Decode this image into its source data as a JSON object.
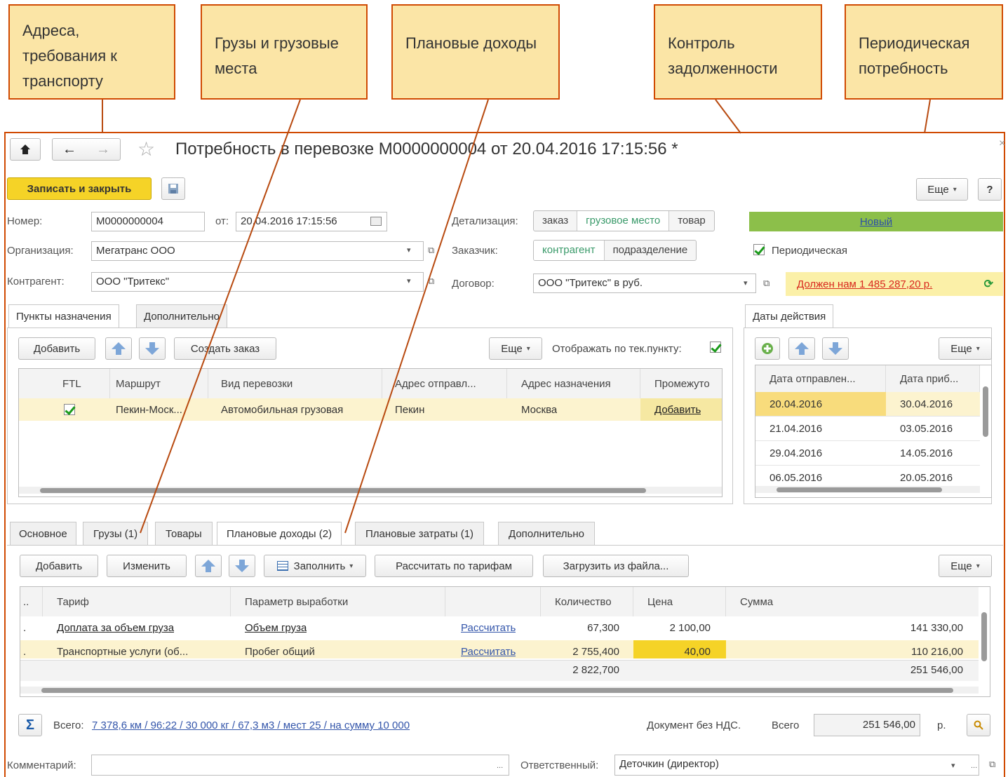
{
  "callouts": [
    "Адреса, требования к транспорту",
    "Грузы и грузовые места",
    "Плановые доходы",
    "Контроль задолженности",
    "Периодическая потребность"
  ],
  "window": {
    "title": "Потребность в перевозке М0000000004 от 20.04.2016 17:15:56 *",
    "close": "×"
  },
  "toolbar": {
    "save_close": "Записать и закрыть",
    "more": "Еще",
    "help": "?"
  },
  "form": {
    "number_label": "Номер:",
    "number_value": "М0000000004",
    "date_label": "от:",
    "date_value": "20.04.2016 17:15:56",
    "org_label": "Организация:",
    "org_value": "Мегатранс ООО",
    "contragent_label": "Контрагент:",
    "contragent_value": "ООО \"Тритекс\"",
    "detail_label": "Детализация:",
    "detail_options": [
      "заказ",
      "грузовое место",
      "товар"
    ],
    "customer_label": "Заказчик:",
    "customer_options": [
      "контрагент",
      "подразделение"
    ],
    "contract_label": "Договор:",
    "contract_value": "ООО \"Тритекс\" в руб.",
    "status": "Новый",
    "periodic_label": "Периодическая",
    "debt": "Должен нам 1 485 287,20 р."
  },
  "upper_tabs": [
    "Пункты назначения",
    "Дополнительно"
  ],
  "destinations": {
    "add": "Добавить",
    "create_order": "Создать заказ",
    "more": "Еще",
    "show_by_point": "Отображать по тек.пункту:",
    "columns": [
      "FTL",
      "Маршрут",
      "Вид перевозки",
      "Адрес отправл...",
      "Адрес назначения",
      "Промежуто"
    ],
    "row": {
      "route": "Пекин-Моск...",
      "transport": "Автомобильная грузовая",
      "from": "Пекин",
      "to": "Москва",
      "intermediate": "Добавить"
    }
  },
  "dates_panel": {
    "tab": "Даты действия",
    "more": "Еще",
    "columns": [
      "Дата отправлен...",
      "Дата приб..."
    ],
    "rows": [
      [
        "20.04.2016",
        "30.04.2016"
      ],
      [
        "21.04.2016",
        "03.05.2016"
      ],
      [
        "29.04.2016",
        "14.05.2016"
      ],
      [
        "06.05.2016",
        "20.05.2016"
      ]
    ]
  },
  "lower_tabs": [
    "Основное",
    "Грузы (1)",
    "Товары",
    "Плановые доходы (2)",
    "Плановые затраты (1)",
    "Дополнительно"
  ],
  "income": {
    "add": "Добавить",
    "edit": "Изменить",
    "fill": "Заполнить",
    "calc_tariffs": "Рассчитать по тарифам",
    "load_file": "Загрузить из файла...",
    "more": "Еще",
    "columns": [
      "Тариф",
      "Параметр выработки",
      "",
      "Количество",
      "Цена",
      "Сумма"
    ],
    "rows": [
      {
        "tariff": "Доплата за объем груза",
        "param": "Объем груза",
        "action": "Рассчитать",
        "qty": "67,300",
        "price": "2 100,00",
        "sum": "141 330,00"
      },
      {
        "tariff": "Транспортные услуги (об...",
        "param": "Пробег общий",
        "action": "Рассчитать",
        "qty": "2 755,400",
        "price": "40,00",
        "sum": "110 216,00"
      }
    ],
    "total_qty": "2 822,700",
    "total_sum": "251 546,00"
  },
  "footer": {
    "sigma": "Σ",
    "total_label": "Всего:",
    "total_link": "7 378,6 км / 96:22 / 30 000 кг / 67,3 м3 / мест 25 / на сумму 10 000",
    "no_vat": "Документ без НДС.",
    "total2_label": "Всего",
    "total2_value": "251 546,00",
    "currency": "р.",
    "comment_label": "Комментарий:",
    "comment_value": "",
    "responsible_label": "Ответственный:",
    "responsible_value": "Деточкин (директор)"
  },
  "colors": {
    "callout_bg": "#fbe5a6",
    "callout_border": "#d04a02",
    "save_button": "#f5d327",
    "status_bar": "#8cbf4a",
    "debt_bg": "#fbf0a8",
    "selected_row": "#fcf3cf"
  }
}
